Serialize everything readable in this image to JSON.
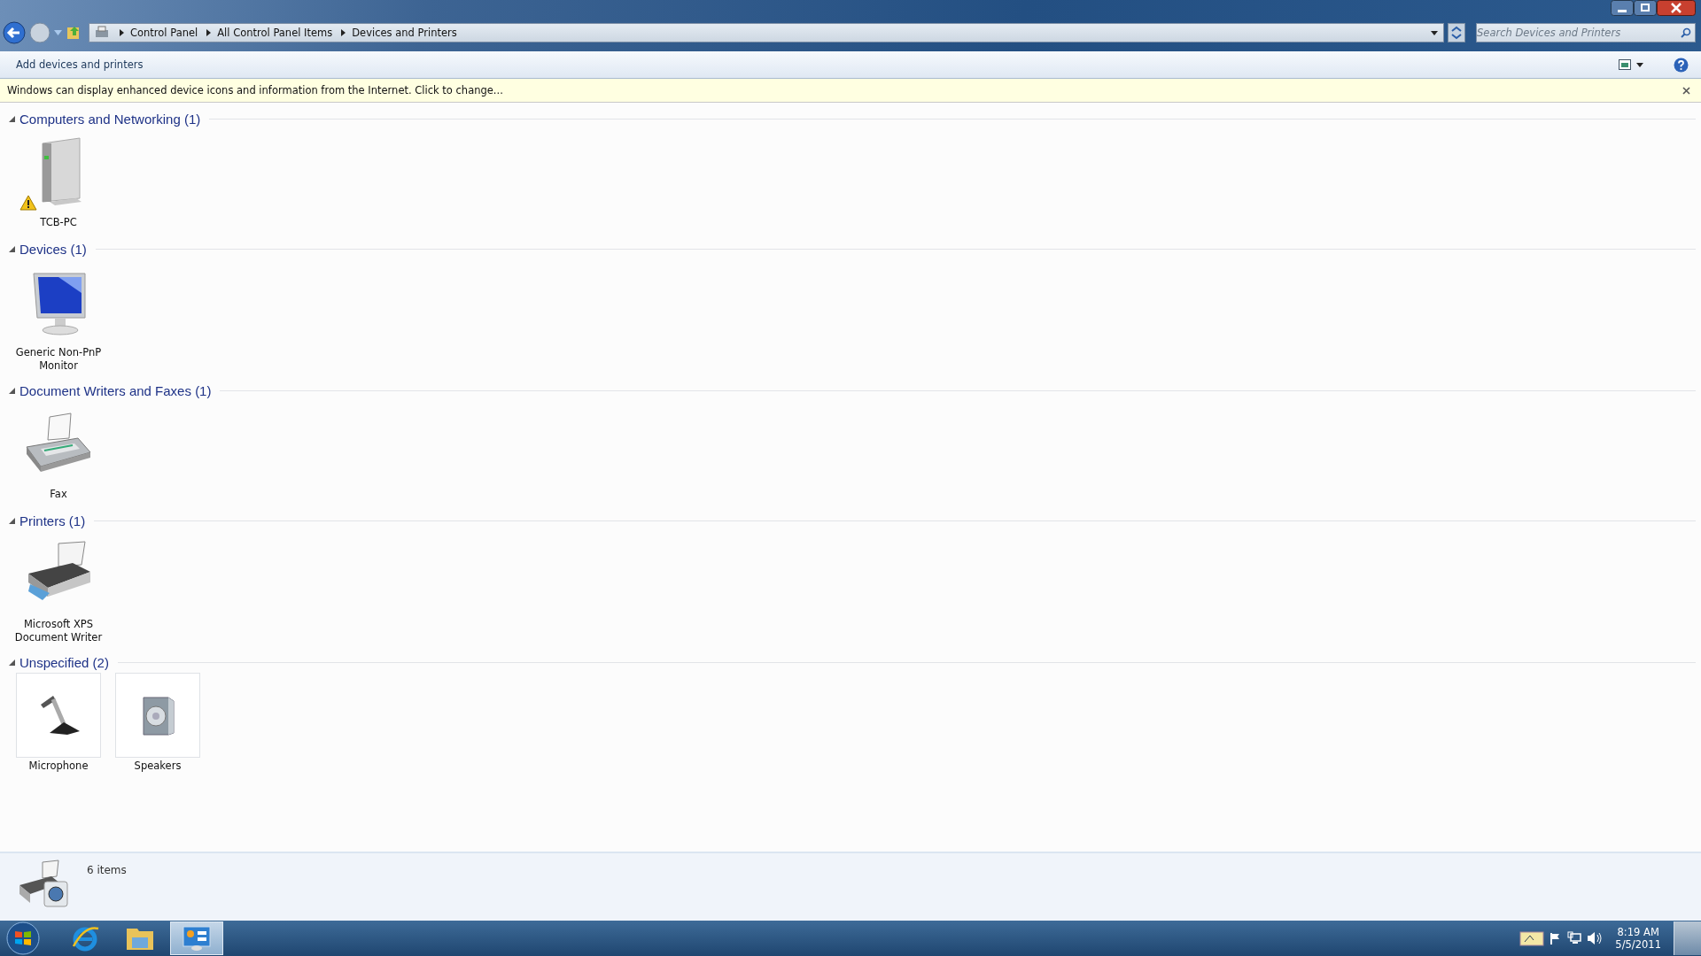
{
  "address_bar": {
    "breadcrumbs": [
      "Control Panel",
      "All Control Panel Items",
      "Devices and Printers"
    ]
  },
  "search": {
    "placeholder": "Search Devices and Printers"
  },
  "command_bar": {
    "items": [
      "Add devices and printers"
    ]
  },
  "info_bar": {
    "text": "Windows can display enhanced device icons and information from the Internet. Click to change..."
  },
  "groups": [
    {
      "title": "Computers and Networking (1)",
      "expanded": true,
      "items": [
        {
          "label": "TCB-PC",
          "kind": "computer",
          "warning": true,
          "framed": false
        }
      ]
    },
    {
      "title": "Devices (1)",
      "expanded": true,
      "items": [
        {
          "label": "Generic Non-PnP Monitor",
          "kind": "monitor",
          "warning": false,
          "framed": false
        }
      ]
    },
    {
      "title": "Document Writers and Faxes (1)",
      "expanded": true,
      "items": [
        {
          "label": "Fax",
          "kind": "fax",
          "warning": false,
          "framed": false
        }
      ]
    },
    {
      "title": "Printers (1)",
      "expanded": true,
      "items": [
        {
          "label": "Microsoft XPS Document Writer",
          "kind": "printer",
          "warning": false,
          "framed": false
        }
      ]
    },
    {
      "title": "Unspecified (2)",
      "expanded": true,
      "items": [
        {
          "label": "Microphone",
          "kind": "microphone",
          "warning": false,
          "framed": true
        },
        {
          "label": "Speakers",
          "kind": "speaker",
          "warning": false,
          "framed": true
        }
      ]
    }
  ],
  "details_pane": {
    "text": "6 items"
  },
  "taskbar": {
    "buttons": [
      {
        "kind": "browser",
        "selected": false
      },
      {
        "kind": "folder",
        "selected": false
      },
      {
        "kind": "control-panel",
        "selected": true
      }
    ],
    "clock": {
      "time": "8:19 AM",
      "date": "5/5/2011"
    }
  }
}
